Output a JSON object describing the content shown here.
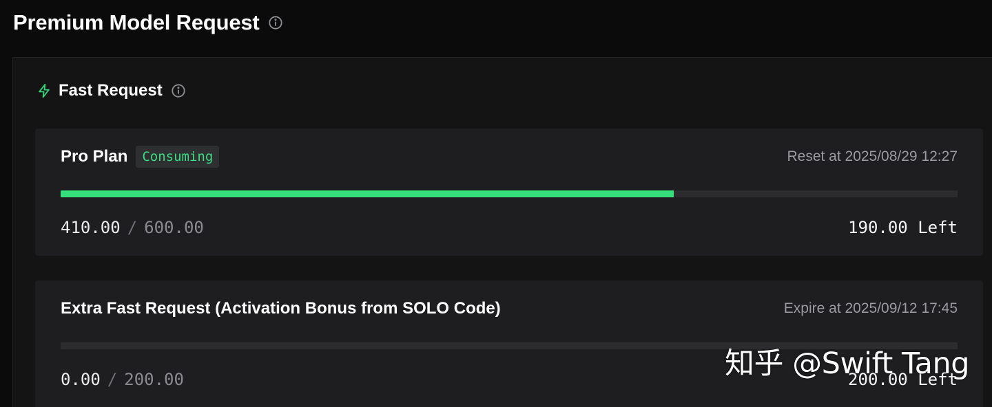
{
  "header": {
    "title": "Premium Model Request",
    "info_icon": "info-circle-icon"
  },
  "fast_request": {
    "title": "Fast Request",
    "icon": "lightning-bolt-icon",
    "accent_color": "#34d47a"
  },
  "cards": [
    {
      "title": "Pro Plan",
      "badge": "Consuming",
      "date_text": "Reset at 2025/08/29 12:27",
      "used": "410.00",
      "separator": "/",
      "total": "600.00",
      "left_text": "190.00 Left",
      "progress_fraction": 0.6833
    },
    {
      "title": "Extra Fast Request (Activation Bonus from SOLO Code)",
      "date_text": "Expire at 2025/09/12 17:45",
      "used": "0.00",
      "separator": "/",
      "total": "200.00",
      "left_text": "200.00 Left",
      "progress_fraction": 0
    }
  ],
  "watermark": "知乎 @Swift Tang",
  "colors": {
    "progress_fill": "#34e07c",
    "badge_text": "#3ddc84"
  }
}
